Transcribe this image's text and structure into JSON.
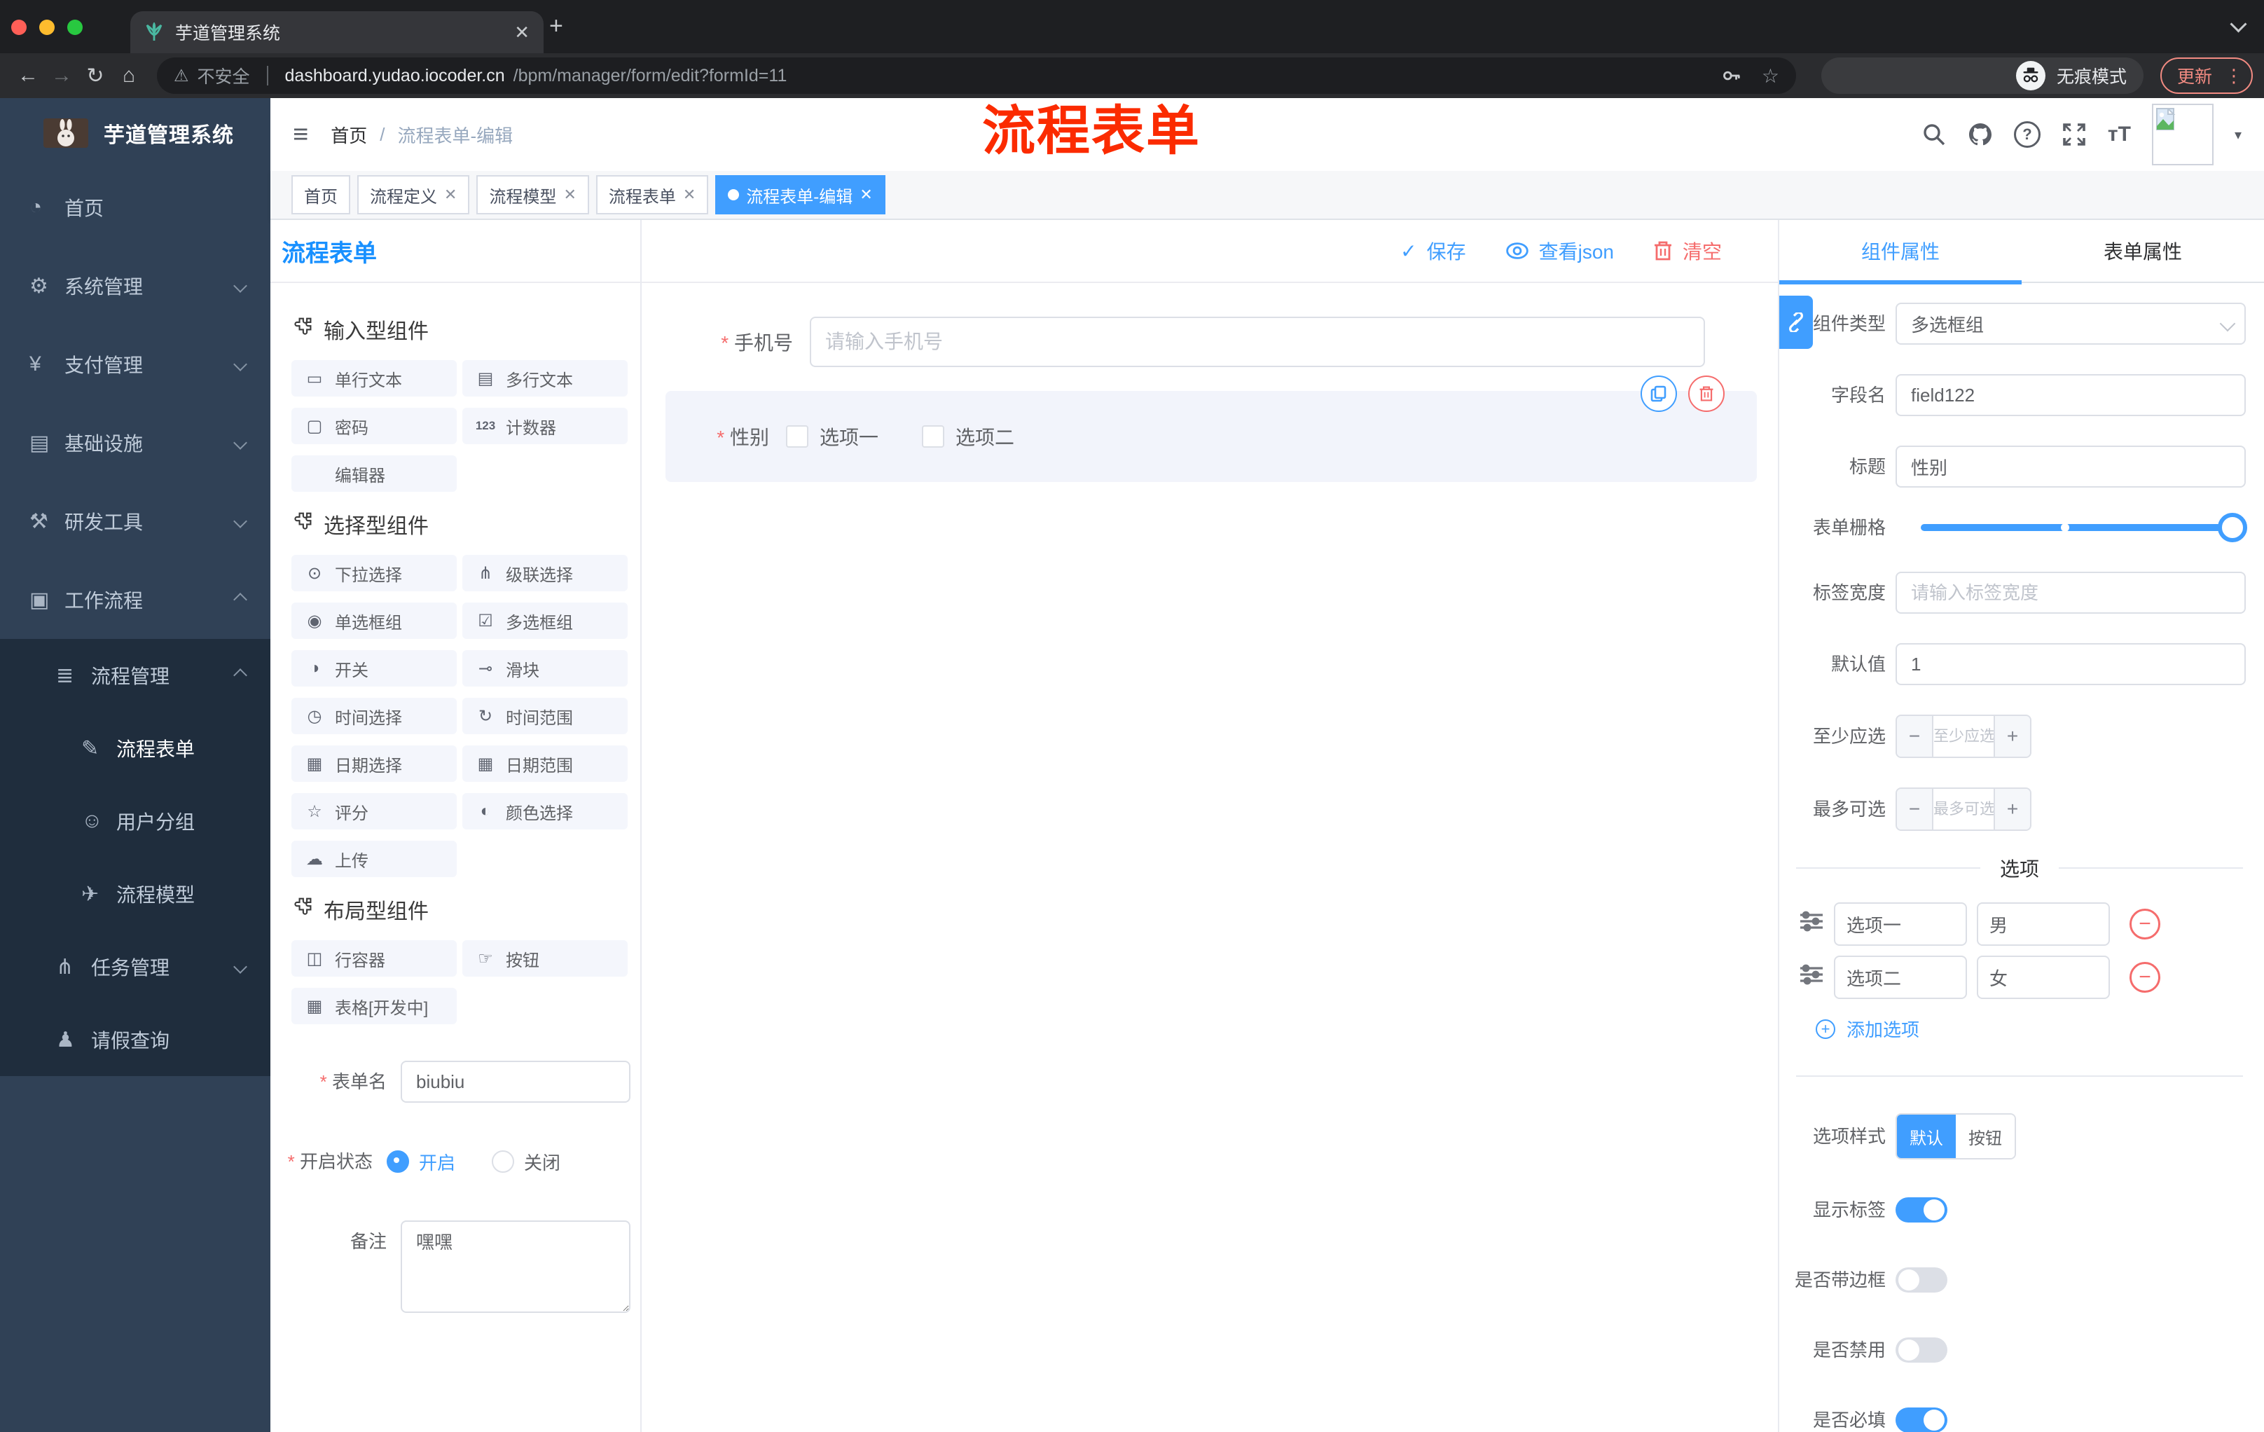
{
  "colors": {
    "accent": "#409eff",
    "danger": "#f56c6c",
    "annotation_red": "#fb2b00",
    "sidebar_bg": "#304156",
    "submenu_bg": "#1f2d3d",
    "tag_active": "#409eff",
    "title_blue": "#1890ff"
  },
  "browser": {
    "tab_title": "芋道管理系统",
    "new_tab_label": "+",
    "close_label": "×",
    "not_secure_label": "不安全",
    "url_domain": "dashboard.yudao.iocoder.cn",
    "url_path": "/bpm/manager/form/edit?formId=11",
    "incognito_label": "无痕模式",
    "update_label": "更新"
  },
  "sidebar": {
    "title": "芋道管理系统",
    "items": [
      {
        "label": "首页",
        "icon": "dashboard-icon",
        "level": 1
      },
      {
        "label": "系统管理",
        "icon": "gear-icon",
        "level": 1,
        "chevron": "down"
      },
      {
        "label": "支付管理",
        "icon": "payment-icon",
        "level": 1,
        "chevron": "down"
      },
      {
        "label": "基础设施",
        "icon": "infra-icon",
        "level": 1,
        "chevron": "down"
      },
      {
        "label": "研发工具",
        "icon": "devtools-icon",
        "level": 1,
        "chevron": "down"
      },
      {
        "label": "工作流程",
        "icon": "workflow-icon",
        "level": 1,
        "chevron": "up"
      },
      {
        "label": "流程管理",
        "icon": "list-icon",
        "level": 2,
        "chevron": "up"
      },
      {
        "label": "流程表单",
        "icon": "form-edit-icon",
        "level": 3,
        "active": true
      },
      {
        "label": "用户分组",
        "icon": "user-group-icon",
        "level": 3
      },
      {
        "label": "流程模型",
        "icon": "paper-plane-icon",
        "level": 3
      },
      {
        "label": "任务管理",
        "icon": "task-tree-icon",
        "level": 2,
        "chevron": "down"
      },
      {
        "label": "请假查询",
        "icon": "person-icon",
        "level": 2
      }
    ]
  },
  "header": {
    "breadcrumb_home": "首页",
    "breadcrumb_separator": "/",
    "breadcrumb_current": "流程表单-编辑",
    "annotation": "流程表单"
  },
  "tagbar": {
    "tags": [
      {
        "label": "首页",
        "closable": false,
        "active": false
      },
      {
        "label": "流程定义",
        "closable": true,
        "active": false
      },
      {
        "label": "流程模型",
        "closable": true,
        "active": false
      },
      {
        "label": "流程表单",
        "closable": true,
        "active": false
      },
      {
        "label": "流程表单-编辑",
        "closable": true,
        "active": true
      }
    ]
  },
  "designer": {
    "title": "流程表单",
    "actions": {
      "save": "保存",
      "view_json": "查看json",
      "clear": "清空"
    }
  },
  "library": {
    "sections": [
      {
        "title": "输入型组件",
        "items": [
          {
            "label": "单行文本",
            "icon": "input-icon"
          },
          {
            "label": "多行文本",
            "icon": "textarea-icon"
          },
          {
            "label": "密码",
            "icon": "password-icon"
          },
          {
            "label": "计数器",
            "icon": "counter-icon"
          },
          {
            "label": "编辑器",
            "icon": "editor-icon"
          }
        ]
      },
      {
        "title": "选择型组件",
        "items": [
          {
            "label": "下拉选择",
            "icon": "select-icon"
          },
          {
            "label": "级联选择",
            "icon": "cascader-icon"
          },
          {
            "label": "单选框组",
            "icon": "radio-icon"
          },
          {
            "label": "多选框组",
            "icon": "checkbox-icon"
          },
          {
            "label": "开关",
            "icon": "switch-icon"
          },
          {
            "label": "滑块",
            "icon": "slider-icon"
          },
          {
            "label": "时间选择",
            "icon": "time-icon"
          },
          {
            "label": "时间范围",
            "icon": "time-range-icon"
          },
          {
            "label": "日期选择",
            "icon": "date-icon"
          },
          {
            "label": "日期范围",
            "icon": "date-range-icon"
          },
          {
            "label": "评分",
            "icon": "rate-icon"
          },
          {
            "label": "颜色选择",
            "icon": "color-icon"
          },
          {
            "label": "上传",
            "icon": "upload-icon"
          }
        ]
      },
      {
        "title": "布局型组件",
        "items": [
          {
            "label": "行容器",
            "icon": "row-icon"
          },
          {
            "label": "按钮",
            "icon": "button-icon"
          },
          {
            "label": "表格[开发中]",
            "icon": "table-icon"
          }
        ]
      }
    ]
  },
  "meta_form": {
    "name_label": "表单名",
    "name_value": "biubiu",
    "status_label": "开启状态",
    "status_options": [
      {
        "label": "开启",
        "selected": true
      },
      {
        "label": "关闭",
        "selected": false
      }
    ],
    "remark_label": "备注",
    "remark_value": "嘿嘿"
  },
  "canvas": {
    "phone": {
      "label": "手机号",
      "placeholder": "请输入手机号",
      "required": true
    },
    "gender": {
      "label": "性别",
      "required": true,
      "options": [
        {
          "label": "选项一",
          "checked": false
        },
        {
          "label": "选项二",
          "checked": false
        }
      ]
    }
  },
  "panel": {
    "tabs": [
      {
        "label": "组件属性",
        "active": true
      },
      {
        "label": "表单属性",
        "active": false
      }
    ],
    "component_type": {
      "label": "组件类型",
      "value": "多选框组"
    },
    "field_name": {
      "label": "字段名",
      "value": "field122"
    },
    "title_field": {
      "label": "标题",
      "value": "性别"
    },
    "grid": {
      "label": "表单栅格",
      "value": 24,
      "min": 0,
      "max": 24,
      "midpoint_mark": 12
    },
    "label_width": {
      "label": "标签宽度",
      "placeholder": "请输入标签宽度"
    },
    "default_value": {
      "label": "默认值",
      "value": "1"
    },
    "min_select": {
      "label": "至少应选",
      "placeholder": "至少应选",
      "minus": "−",
      "plus": "+"
    },
    "max_select": {
      "label": "最多可选",
      "placeholder": "最多可选",
      "minus": "−",
      "plus": "+"
    },
    "options": {
      "divider_title": "选项",
      "rows": [
        {
          "label": "选项一",
          "value": "男"
        },
        {
          "label": "选项二",
          "value": "女"
        }
      ],
      "add_label": "添加选项"
    },
    "option_style": {
      "label": "选项样式",
      "choices": [
        {
          "label": "默认",
          "active": true
        },
        {
          "label": "按钮",
          "active": false
        }
      ]
    },
    "switches": [
      {
        "label": "显示标签",
        "on": true
      },
      {
        "label": "是否带边框",
        "on": false
      },
      {
        "label": "是否禁用",
        "on": false
      },
      {
        "label": "是否必填",
        "on": true
      }
    ]
  }
}
